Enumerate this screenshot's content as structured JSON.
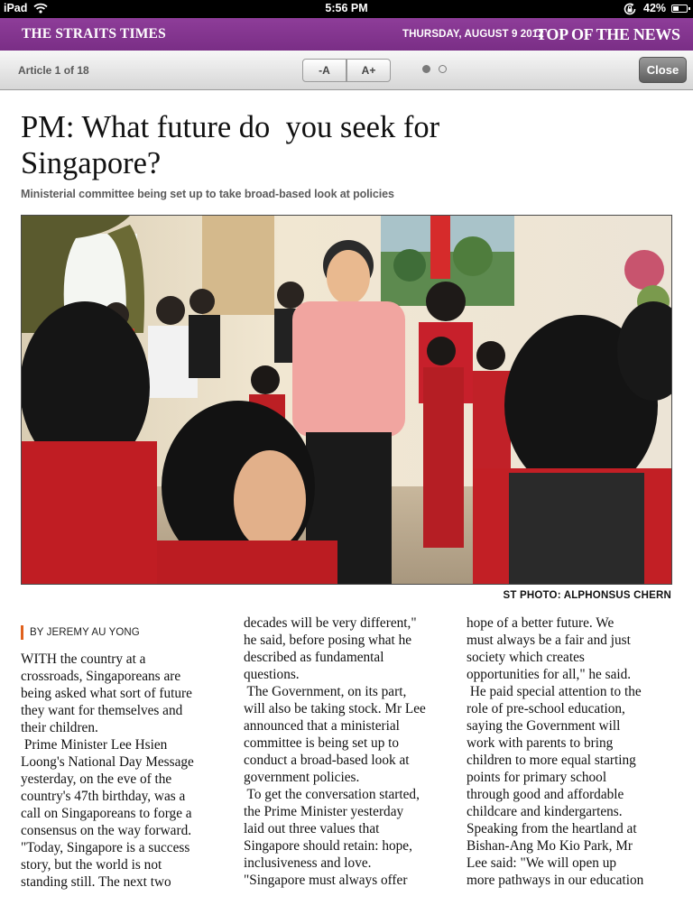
{
  "status_bar": {
    "device": "iPad",
    "time": "5:56 PM",
    "battery": "42%",
    "battery_level": 0.42
  },
  "masthead": {
    "title": "THE STRAITS TIMES",
    "date": "THURSDAY, AUGUST 9 2012",
    "section": "TOP OF THE NEWS",
    "color": "#8e3d99"
  },
  "toolbar": {
    "article_position": "Article 1 of 18",
    "decrease_font": "-A",
    "increase_font": "A+",
    "pages": 2,
    "current_page": 1,
    "close": "Close"
  },
  "article": {
    "headline_lines": [
      "PM: What future do  you seek for",
      "Singapore?"
    ],
    "subheadline": "Ministerial committee being set up to take broad-based look at policies",
    "photo_credit": "ST PHOTO: ALPHONSUS CHERN",
    "byline": "BY JEREMY AU YONG",
    "byline_accent": "#e0611d",
    "columns": [
      [
        "WITH the country at a",
        "crossroads, Singaporeans are",
        "being asked what sort of future",
        "they want for themselves and",
        "their children.",
        " Prime Minister Lee Hsien",
        "Loong's National Day Message",
        "yesterday, on the eve of the",
        "country's 47th birthday, was a",
        "call on Singaporeans to forge a",
        "consensus on the way forward.",
        "\"Today, Singapore is a success",
        "story, but the world is not",
        "standing still. The next two"
      ],
      [
        "decades will be very different,\"",
        "he said, before posing what he",
        "described as fundamental",
        "questions.",
        " The Government, on its part,",
        "will also be taking stock. Mr Lee",
        "announced that a ministerial",
        "committee is being set up to",
        "conduct a broad-based look at",
        "government policies.",
        " To get the conversation started,",
        "the Prime Minister yesterday",
        "laid out three values that",
        "Singapore should retain: hope,",
        "inclusiveness and love.",
        "\"Singapore must always offer"
      ],
      [
        "hope of a better future. We",
        "must always be a fair and just",
        "society which creates",
        "opportunities for all,\" he said.",
        " He paid special attention to the",
        "role of pre-school education,",
        "saying the Government will",
        "work with parents to bring",
        "children to more equal starting",
        "points for primary school",
        "through good and affordable",
        "childcare and kindergartens.",
        "Speaking from the heartland at",
        "Bishan-Ang Mo Kio Park, Mr",
        "Lee said: \"We will open up",
        "more pathways in our education"
      ]
    ]
  }
}
